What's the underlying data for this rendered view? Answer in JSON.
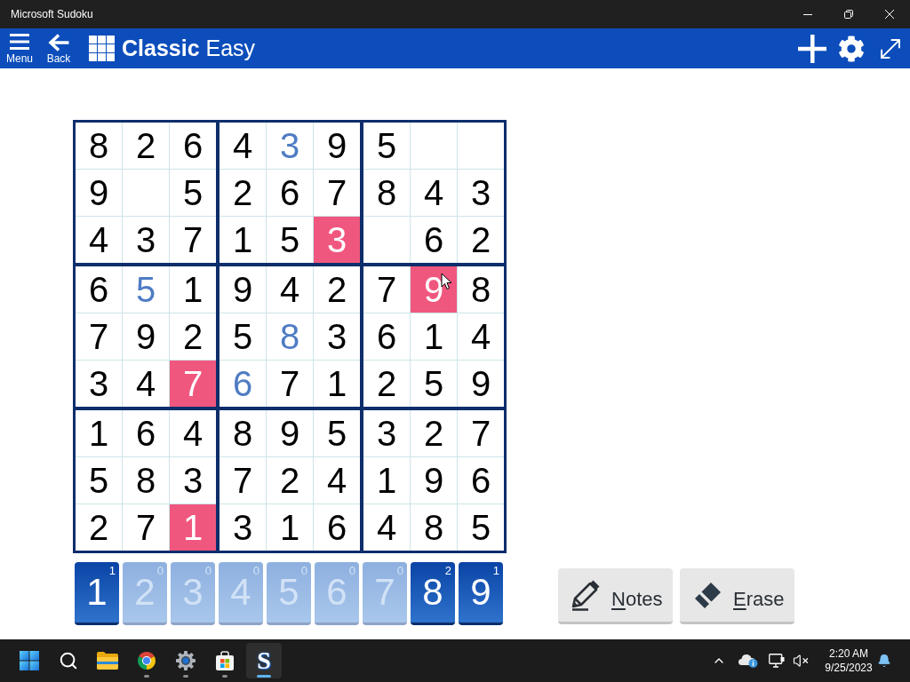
{
  "window": {
    "title": "Microsoft Sudoku"
  },
  "header": {
    "nav": [
      {
        "kind": "menu",
        "label": "Menu"
      },
      {
        "kind": "back",
        "label": "Back"
      }
    ],
    "title": {
      "mode": "Classic",
      "difficulty": "Easy"
    }
  },
  "board": {
    "rows": [
      [
        {
          "kind": "given",
          "value": "8"
        },
        {
          "kind": "given",
          "value": "2"
        },
        {
          "kind": "given",
          "value": "6"
        },
        {
          "kind": "given",
          "value": "4"
        },
        {
          "kind": "entered",
          "value": "3"
        },
        {
          "kind": "given",
          "value": "9"
        },
        {
          "kind": "given",
          "value": "5"
        },
        {
          "kind": "empty"
        },
        {
          "kind": "empty"
        }
      ],
      [
        {
          "kind": "given",
          "value": "9"
        },
        {
          "kind": "empty"
        },
        {
          "kind": "given",
          "value": "5"
        },
        {
          "kind": "given",
          "value": "2"
        },
        {
          "kind": "given",
          "value": "6"
        },
        {
          "kind": "given",
          "value": "7"
        },
        {
          "kind": "given",
          "value": "8"
        },
        {
          "kind": "given",
          "value": "4"
        },
        {
          "kind": "given",
          "value": "3"
        }
      ],
      [
        {
          "kind": "given",
          "value": "4"
        },
        {
          "kind": "given",
          "value": "3"
        },
        {
          "kind": "given",
          "value": "7"
        },
        {
          "kind": "given",
          "value": "1"
        },
        {
          "kind": "given",
          "value": "5"
        },
        {
          "kind": "error",
          "value": "3"
        },
        {
          "kind": "empty"
        },
        {
          "kind": "given",
          "value": "6"
        },
        {
          "kind": "given",
          "value": "2"
        }
      ],
      [
        {
          "kind": "given",
          "value": "6"
        },
        {
          "kind": "entered",
          "value": "5"
        },
        {
          "kind": "given",
          "value": "1"
        },
        {
          "kind": "given",
          "value": "9"
        },
        {
          "kind": "given",
          "value": "4"
        },
        {
          "kind": "given",
          "value": "2"
        },
        {
          "kind": "given",
          "value": "7"
        },
        {
          "kind": "error",
          "value": "9"
        },
        {
          "kind": "given",
          "value": "8"
        }
      ],
      [
        {
          "kind": "given",
          "value": "7"
        },
        {
          "kind": "given",
          "value": "9"
        },
        {
          "kind": "given",
          "value": "2"
        },
        {
          "kind": "given",
          "value": "5"
        },
        {
          "kind": "entered",
          "value": "8"
        },
        {
          "kind": "given",
          "value": "3"
        },
        {
          "kind": "given",
          "value": "6"
        },
        {
          "kind": "given",
          "value": "1"
        },
        {
          "kind": "given",
          "value": "4"
        }
      ],
      [
        {
          "kind": "given",
          "value": "3"
        },
        {
          "kind": "given",
          "value": "4"
        },
        {
          "kind": "error",
          "value": "7"
        },
        {
          "kind": "entered",
          "value": "6"
        },
        {
          "kind": "given",
          "value": "7"
        },
        {
          "kind": "given",
          "value": "1"
        },
        {
          "kind": "given",
          "value": "2"
        },
        {
          "kind": "given",
          "value": "5"
        },
        {
          "kind": "given",
          "value": "9"
        }
      ],
      [
        {
          "kind": "given",
          "value": "1"
        },
        {
          "kind": "given",
          "value": "6"
        },
        {
          "kind": "given",
          "value": "4"
        },
        {
          "kind": "given",
          "value": "8"
        },
        {
          "kind": "given",
          "value": "9"
        },
        {
          "kind": "given",
          "value": "5"
        },
        {
          "kind": "given",
          "value": "3"
        },
        {
          "kind": "given",
          "value": "2"
        },
        {
          "kind": "given",
          "value": "7"
        }
      ],
      [
        {
          "kind": "given",
          "value": "5"
        },
        {
          "kind": "given",
          "value": "8"
        },
        {
          "kind": "given",
          "value": "3"
        },
        {
          "kind": "given",
          "value": "7"
        },
        {
          "kind": "given",
          "value": "2"
        },
        {
          "kind": "given",
          "value": "4"
        },
        {
          "kind": "given",
          "value": "1"
        },
        {
          "kind": "given",
          "value": "9"
        },
        {
          "kind": "given",
          "value": "6"
        }
      ],
      [
        {
          "kind": "given",
          "value": "2"
        },
        {
          "kind": "given",
          "value": "7"
        },
        {
          "kind": "error",
          "value": "1"
        },
        {
          "kind": "given",
          "value": "3"
        },
        {
          "kind": "given",
          "value": "1"
        },
        {
          "kind": "given",
          "value": "6"
        },
        {
          "kind": "given",
          "value": "4"
        },
        {
          "kind": "given",
          "value": "8"
        },
        {
          "kind": "given",
          "value": "5"
        }
      ]
    ]
  },
  "number_pad": [
    {
      "digit": "1",
      "count": "1",
      "disabled": false
    },
    {
      "digit": "2",
      "count": "0",
      "disabled": true
    },
    {
      "digit": "3",
      "count": "0",
      "disabled": true
    },
    {
      "digit": "4",
      "count": "0",
      "disabled": true
    },
    {
      "digit": "5",
      "count": "0",
      "disabled": true
    },
    {
      "digit": "6",
      "count": "0",
      "disabled": true
    },
    {
      "digit": "7",
      "count": "0",
      "disabled": true
    },
    {
      "digit": "8",
      "count": "2",
      "disabled": false
    },
    {
      "digit": "9",
      "count": "1",
      "disabled": false
    }
  ],
  "tools": [
    {
      "kind": "notes",
      "access_key": "N",
      "label_rest": "otes"
    },
    {
      "kind": "erase",
      "access_key": "E",
      "label_rest": "rase"
    }
  ],
  "taskbar": {
    "apps": [
      {
        "kind": "start",
        "running": false,
        "selected": false
      },
      {
        "kind": "search",
        "running": false,
        "selected": false
      },
      {
        "kind": "files",
        "running": false,
        "selected": false
      },
      {
        "kind": "browser",
        "running": true,
        "selected": false
      },
      {
        "kind": "settings",
        "running": true,
        "selected": false
      },
      {
        "kind": "store",
        "running": true,
        "selected": false
      },
      {
        "kind": "app",
        "glyph": "S",
        "running": true,
        "selected": true
      }
    ],
    "clock": {
      "time": "2:20 AM",
      "date": "9/25/2023"
    }
  }
}
